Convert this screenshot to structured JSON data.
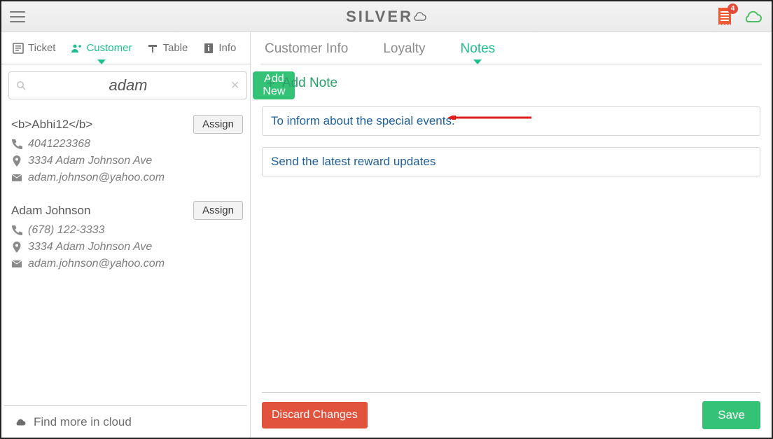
{
  "header": {
    "brand": "SILVER",
    "badge_count": "4"
  },
  "left_tabs": {
    "ticket": "Ticket",
    "customer": "Customer",
    "table": "Table",
    "info": "Info"
  },
  "search": {
    "value": "adam",
    "add_new": "Add New"
  },
  "customers": [
    {
      "name": "<b>Abhi12</b>",
      "phone": "4041223368",
      "address": "3334 Adam Johnson Ave",
      "email": "adam.johnson@yahoo.com",
      "assign": "Assign"
    },
    {
      "name": "Adam Johnson",
      "phone": "(678) 122-3333",
      "address": "3334 Adam Johnson Ave",
      "email": "adam.johnson@yahoo.com",
      "assign": "Assign"
    }
  ],
  "cloud_more": "Find more in cloud",
  "right_tabs": {
    "info": "Customer Info",
    "loyalty": "Loyalty",
    "notes": "Notes"
  },
  "notes": {
    "add_label": "Add Note",
    "items": [
      "To inform about the special events.",
      "Send the latest reward updates"
    ]
  },
  "footer": {
    "discard": "Discard Changes",
    "save": "Save"
  }
}
